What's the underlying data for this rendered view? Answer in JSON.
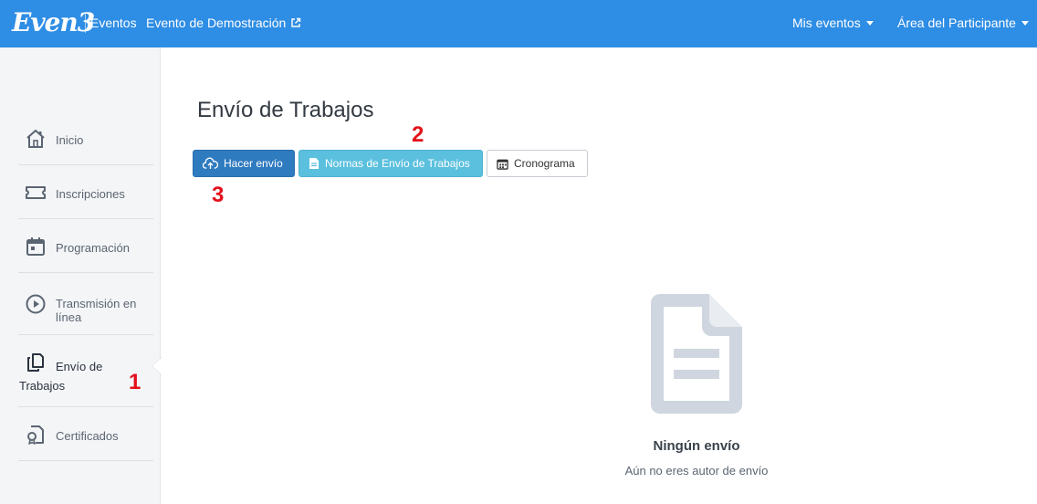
{
  "header": {
    "logo": "Even3",
    "nav_eventos": "Eventos",
    "event_link": "Evento de Demostración",
    "my_events": "Mis eventos",
    "participant_area": "Área del Participante"
  },
  "sidebar": {
    "items": [
      {
        "label": "Inicio",
        "icon": "home-icon"
      },
      {
        "label": "Inscripciones",
        "icon": "ticket-icon"
      },
      {
        "label": "Programación",
        "icon": "calendar-icon"
      },
      {
        "label": "Transmisión en línea",
        "icon": "play-circle-icon"
      },
      {
        "label": "Envío de Trabajos",
        "icon": "documents-icon",
        "active": true
      },
      {
        "label": "Certificados",
        "icon": "certificate-icon"
      }
    ]
  },
  "main": {
    "title": "Envío de Trabajos",
    "buttons": {
      "submit": "Hacer envío",
      "rules": "Normas de Envío de Trabajos",
      "schedule": "Cronograma"
    },
    "empty_state": {
      "title": "Ningún envío",
      "subtitle": "Aún no eres autor de envío",
      "icon": "file-text-icon"
    }
  },
  "annotations": {
    "marker_1": "1",
    "marker_2": "2",
    "marker_3": "3"
  },
  "colors": {
    "header_bg": "#2e8de4",
    "primary_button": "#2f7bbf",
    "info_button": "#5bc0de",
    "annotation_red": "#e3101a",
    "empty_icon": "#cfd6df"
  }
}
